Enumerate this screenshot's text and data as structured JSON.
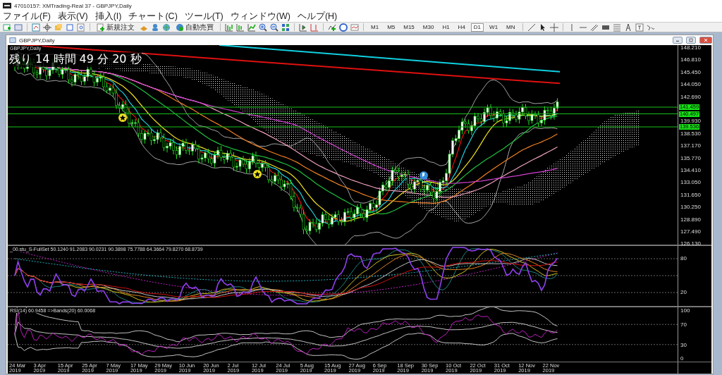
{
  "window": {
    "title": "47010157: XMTrading-Real 37 - GBPJPY,Daily"
  },
  "menu": [
    "ファイル(F)",
    "表示(V)",
    "挿入(I)",
    "チャート(C)",
    "ツール(T)",
    "ウィンドウ(W)",
    "ヘルプ(H)"
  ],
  "toolbar": {
    "order_button": "新規注文",
    "autotrade_button": "自動売買",
    "timeframes": [
      {
        "label": "M1",
        "selected": false
      },
      {
        "label": "M5",
        "selected": false
      },
      {
        "label": "M15",
        "selected": false
      },
      {
        "label": "M30",
        "selected": false
      },
      {
        "label": "H1",
        "selected": false
      },
      {
        "label": "H4",
        "selected": false
      },
      {
        "label": "D1",
        "selected": true
      },
      {
        "label": "W1",
        "selected": false
      },
      {
        "label": "MN",
        "selected": false
      }
    ]
  },
  "chart_window": {
    "title": "GBPJPY,Daily",
    "symbol_label": "GBPJPY,Daily",
    "countdown": "残り 14 時間 49 分 20 秒",
    "price_ticks": [
      "148.210",
      "146.810",
      "145.450",
      "144.050",
      "142.690",
      "139.930",
      "138.530",
      "137.170",
      "135.770",
      "134.410",
      "133.050",
      "131.650",
      "130.250",
      "128.890",
      "127.490",
      "126.130"
    ],
    "price_markers": [
      "141.459",
      "140.497",
      "139.536"
    ],
    "oscillator": {
      "label": "_00.stu_S-FullSet 50.1240 91.2083 90.0231 90.3898 75.7788 64.3664 79.8270 68.8739",
      "ticks": [
        "80",
        "20"
      ]
    },
    "rsi": {
      "label": "RSI(14) 60.9458  =>Bands(20) 60.0068",
      "ticks": [
        "100",
        "70",
        "30",
        "0"
      ]
    },
    "dates": [
      "24 Mar 2019",
      "3 Apr 2019",
      "15 Apr 2019",
      "25 Apr 2019",
      "7 May 2019",
      "17 May 2019",
      "29 May 2019",
      "10 Jun 2019",
      "20 Jun 2019",
      "2 Jul 2019",
      "12 Jul 2019",
      "24 Jul 2019",
      "5 Aug 2019",
      "15 Aug 2019",
      "27 Aug 2019",
      "6 Sep 2019",
      "18 Sep 2019",
      "30 Sep 2019",
      "10 Oct 2019",
      "22 Oct 2019",
      "31 Oct 2019",
      "12 Nov 2019",
      "22 Nov 2019"
    ]
  }
}
